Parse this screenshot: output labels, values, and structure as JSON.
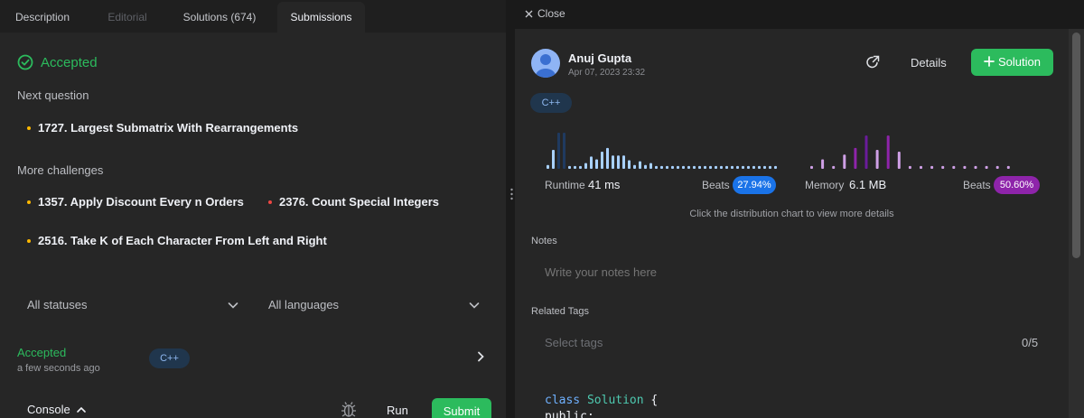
{
  "tabs": [
    {
      "label": "Description",
      "state": "normal"
    },
    {
      "label": "Editorial",
      "state": "disabled"
    },
    {
      "label": "Solutions (674)",
      "state": "normal"
    },
    {
      "label": "Submissions",
      "state": "active"
    }
  ],
  "result": {
    "status": "Accepted"
  },
  "next_question": {
    "label": "Next question",
    "items": [
      {
        "title": "1727. Largest Submatrix With Rearrangements",
        "dot_color": "#ffb800"
      }
    ]
  },
  "more_challenges": {
    "label": "More challenges",
    "items": [
      {
        "title": "1357. Apply Discount Every n Orders",
        "dot_color": "#ffb800"
      },
      {
        "title": "2376. Count Special Integers",
        "dot_color": "#ef4743"
      },
      {
        "title": "2516. Take K of Each Character From Left and Right",
        "dot_color": "#ffb800"
      }
    ]
  },
  "filters": {
    "status": "All statuses",
    "language": "All languages"
  },
  "submission": {
    "status": "Accepted",
    "time": "a few seconds ago",
    "language": "C++"
  },
  "console": {
    "label": "Console",
    "run_label": "Run",
    "submit_label": "Submit"
  },
  "detail": {
    "close_label": "Close",
    "user_name": "Anuj Gupta",
    "date": "Apr 07, 2023 23:32",
    "details_label": "Details",
    "solution_label": "Solution",
    "language": "C++",
    "runtime": {
      "label": "Runtime",
      "value": "41 ms",
      "beats_label": "Beats",
      "beats": "27.94%"
    },
    "memory": {
      "label": "Memory",
      "value": "6.1 MB",
      "beats_label": "Beats",
      "beats": "50.60%"
    },
    "chart_hint": "Click the distribution chart to view more details",
    "notes_label": "Notes",
    "notes_placeholder": "Write your notes here",
    "tags_label": "Related Tags",
    "tags_placeholder": "Select tags",
    "tags_count": "0/5",
    "code_line1_kw": "class",
    "code_line1_cls": "Solution",
    "code_line1_rest": " {",
    "code_line2": "public:"
  },
  "chart_data": [
    {
      "type": "bar",
      "title": "",
      "series": [
        {
          "values": [
            4,
            20,
            38,
            38,
            3,
            3,
            3,
            6,
            13,
            10,
            18,
            22,
            14,
            14,
            14,
            9,
            4,
            8,
            4,
            6,
            3,
            3,
            3,
            3,
            3,
            3,
            3,
            3,
            3,
            3,
            3,
            3,
            3,
            3,
            3,
            3,
            3,
            3,
            3,
            3,
            3,
            3,
            3
          ]
        }
      ],
      "highlight_index": 2,
      "accent": "#a8d1ff",
      "highlight_color": "#1f3a5f"
    },
    {
      "type": "bar",
      "title": "",
      "series": [
        {
          "values": [
            3,
            10,
            3,
            15,
            22,
            35,
            20,
            35,
            18,
            3,
            3,
            3,
            3,
            3,
            3,
            3,
            3,
            3,
            3
          ]
        }
      ],
      "highlight_index": 5,
      "accent": "#cfa0e6",
      "highlight_color": "#6a1b9a"
    }
  ],
  "colors": {
    "accent_green": "#2cbb5d",
    "runtime_beats": "#1a73e8",
    "memory_beats": "#8e24aa"
  }
}
